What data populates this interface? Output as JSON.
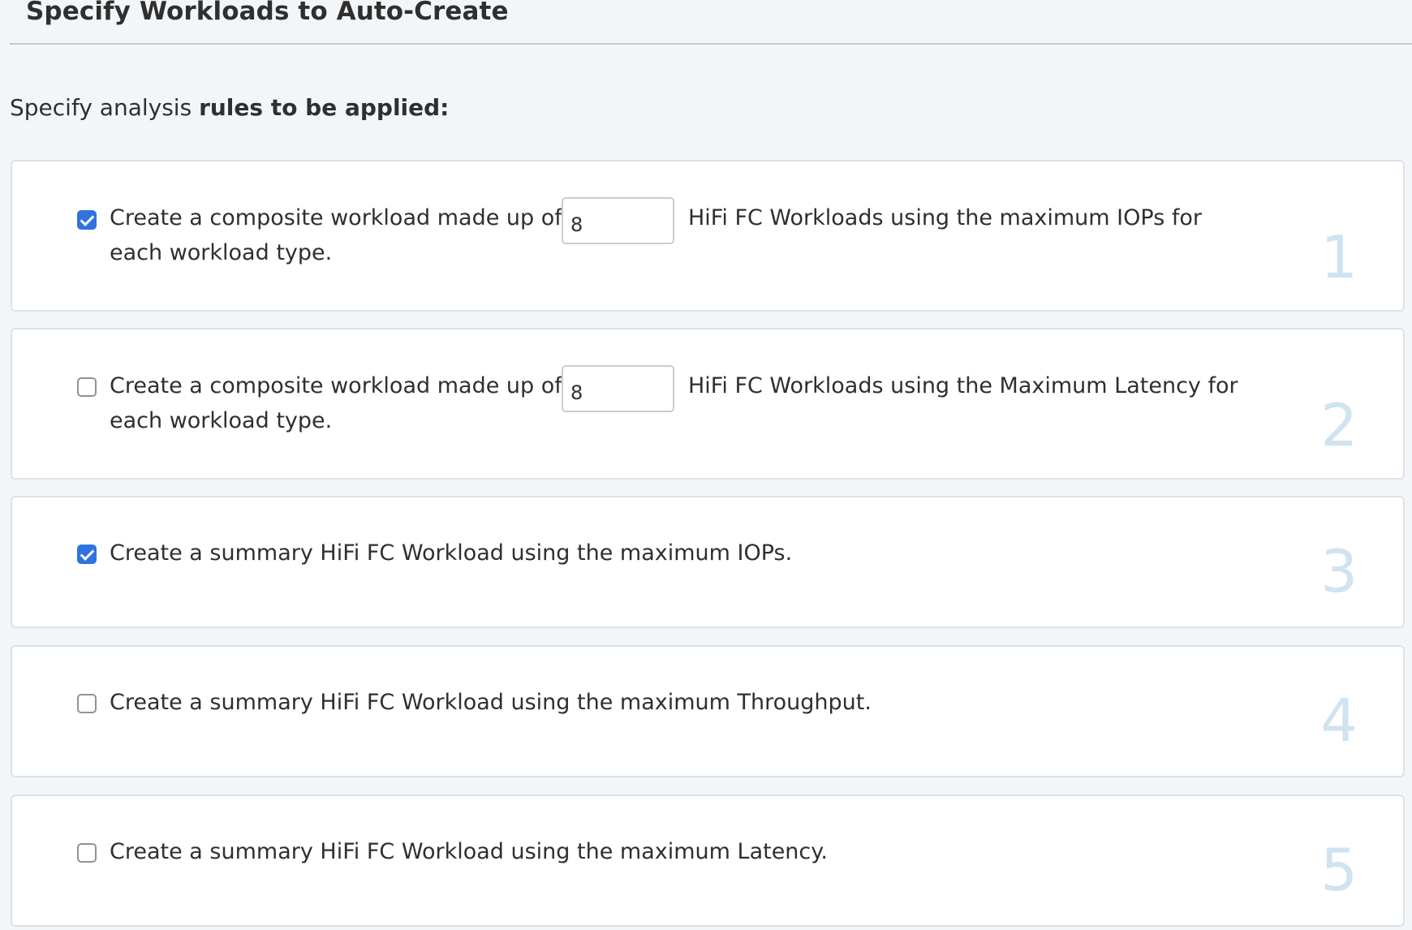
{
  "header": {
    "title": "Specify Workloads to Auto-Create"
  },
  "intro": {
    "prefix": "Specify analysis",
    "bold": "rules to be applied:"
  },
  "rules": [
    {
      "number": "1",
      "checked": true,
      "text_before": "Create a composite workload made up of",
      "input_value": "8",
      "text_after": "HiFi FC Workloads using the maximum IOPs for",
      "text_line2": "each workload type."
    },
    {
      "number": "2",
      "checked": false,
      "text_before": "Create a composite workload made up of",
      "input_value": "8",
      "text_after": "HiFi FC Workloads using the Maximum Latency for",
      "text_line2": "each workload type."
    },
    {
      "number": "3",
      "checked": true,
      "text": "Create a summary HiFi FC Workload using the maximum IOPs."
    },
    {
      "number": "4",
      "checked": false,
      "text": "Create a summary HiFi FC Workload using the maximum Throughput."
    },
    {
      "number": "5",
      "checked": false,
      "text": "Create a summary HiFi FC Workload using the maximum Latency."
    }
  ],
  "colors": {
    "checkbox_checked": "#2f72e0",
    "rule_number": "#cfe3f0",
    "background": "#f3f6f9",
    "card": "#ffffff"
  }
}
